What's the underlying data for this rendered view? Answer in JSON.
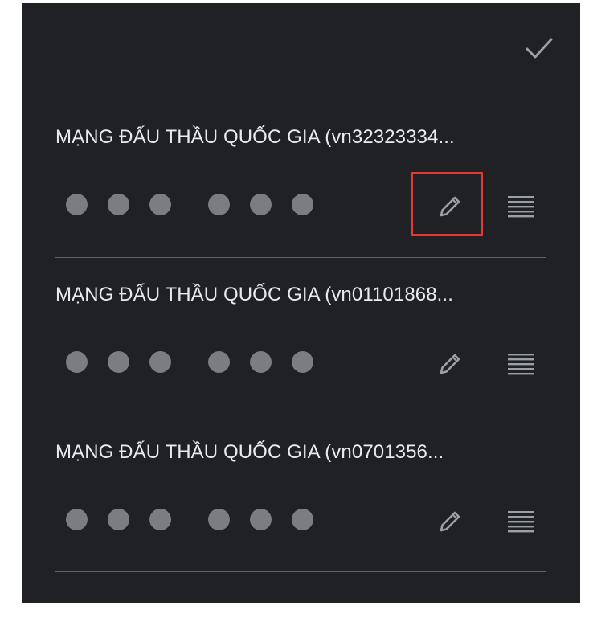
{
  "header": {
    "done_icon": "checkmark-icon"
  },
  "accounts": [
    {
      "title": "MẠNG ĐẤU THẦU QUỐC GIA (vn32323334...",
      "password_mask": "••••••",
      "edit_icon": "pencil-icon",
      "drag_icon": "drag-handle-icon"
    },
    {
      "title": "MẠNG ĐẤU THẦU QUỐC GIA (vn01101868...",
      "password_mask": "••••••",
      "edit_icon": "pencil-icon",
      "drag_icon": "drag-handle-icon"
    },
    {
      "title": "MẠNG ĐẤU THẦU QUỐC GIA (vn0701356...",
      "password_mask": "••••••",
      "edit_icon": "pencil-icon",
      "drag_icon": "drag-handle-icon"
    }
  ],
  "colors": {
    "background": "#202124",
    "text": "#e8eaed",
    "icon": "#9aa0a6",
    "dot": "#7c7d80",
    "highlight": "#e53935"
  }
}
